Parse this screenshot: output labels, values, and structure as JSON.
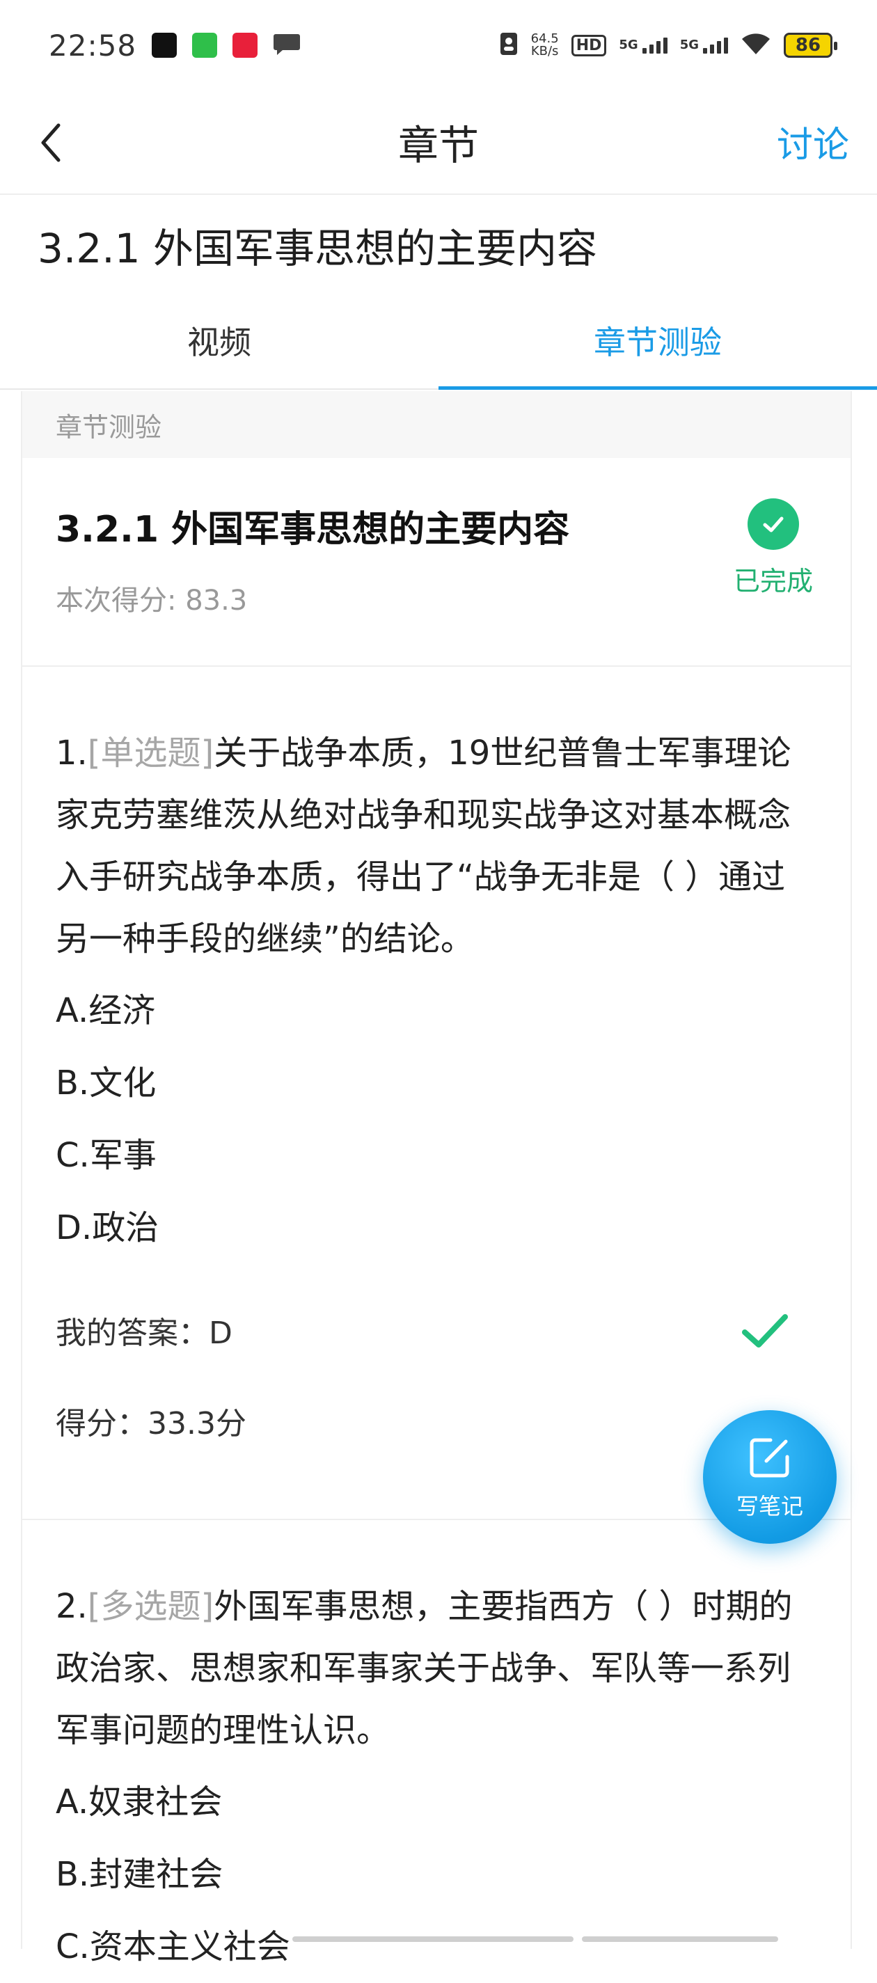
{
  "status_bar": {
    "time": "22:58",
    "net_speed_value": "64.5",
    "net_speed_unit": "KB/s",
    "hd_label": "HD",
    "sig1_label": "5G",
    "sig2_label": "5G",
    "battery": "86"
  },
  "nav": {
    "title": "章节",
    "discuss_label": "讨论"
  },
  "chapter_title": "3.2.1 外国军事思想的主要内容",
  "tabs": [
    {
      "label": "视频"
    },
    {
      "label": "章节测验"
    }
  ],
  "section_header": "章节测验",
  "quiz": {
    "title": "3.2.1 外国军事思想的主要内容",
    "score_text": "本次得分: 83.3",
    "status": "已完成"
  },
  "questions": [
    {
      "number": "1.",
      "type": "[单选题]",
      "text": "关于战争本质，19世纪普鲁士军事理论家克劳塞维茨从绝对战争和现实战争这对基本概念入手研究战争本质，得出了“战争无非是（ ）通过另一种手段的继续”的结论。",
      "options": [
        "A.经济",
        "B.文化",
        "C.军事",
        "D.政治"
      ],
      "my_answer": "我的答案：D",
      "score": "得分：33.3分"
    },
    {
      "number": "2.",
      "type": "[多选题]",
      "text": "外国军事思想，主要指西方（ ）时期的政治家、思想家和军事家关于战争、军队等一系列军事问题的理性认识。",
      "options": [
        "A.奴隶社会",
        "B.封建社会",
        "C.资本主义社会"
      ]
    }
  ],
  "fab": {
    "label": "写笔记"
  },
  "colors": {
    "accent": "#1a9be6",
    "success": "#22c07e",
    "muted": "#999999"
  }
}
